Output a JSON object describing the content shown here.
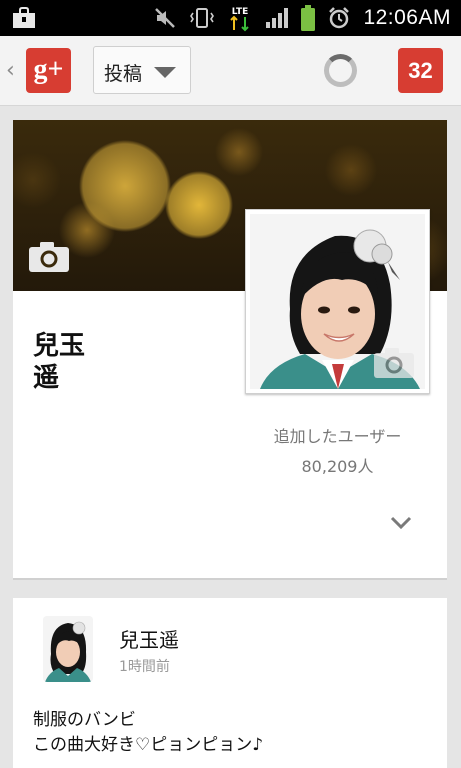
{
  "status_bar": {
    "time": "12:06AM",
    "network": "LTE",
    "icons": [
      "bag-icon",
      "mute-icon",
      "vibrate-icon",
      "lte-icon",
      "signal-icon",
      "battery-icon",
      "alarm-icon"
    ]
  },
  "action_bar": {
    "app_logo_text": "g+",
    "view_spinner_label": "投稿",
    "notification_count": "32"
  },
  "profile": {
    "name_line1": "兒玉",
    "name_line2": "遥",
    "followers_label": "追加したユーザー",
    "followers_count": "80,209人"
  },
  "post": {
    "author": "兒玉遥",
    "time": "1時間前",
    "line1": "制服のバンビ",
    "line2": "この曲大好き♡ピョンピョン♪"
  },
  "colors": {
    "accent_red": "#d73d32",
    "status_bar_bg": "#000000",
    "card_bg": "#ffffff",
    "page_bg": "#e5e5e5"
  }
}
